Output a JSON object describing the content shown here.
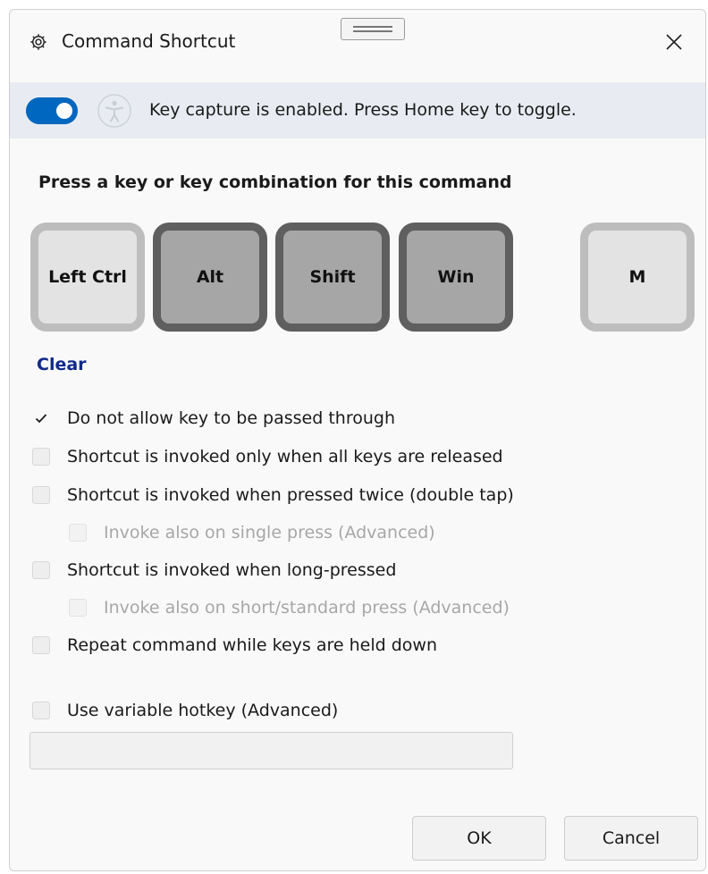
{
  "window": {
    "title": "Command Shortcut",
    "title_icon": "gear-icon",
    "close_icon": "close-icon"
  },
  "capture_bar": {
    "toggle_on": true,
    "message": "Key capture is enabled. Press Home key to toggle.",
    "accessibility_icon": "accessibility-icon"
  },
  "prompt": "Press a key or key combination for this command",
  "keys": [
    {
      "label": "Left Ctrl",
      "state": "inactive"
    },
    {
      "label": "Alt",
      "state": "active"
    },
    {
      "label": "Shift",
      "state": "active"
    },
    {
      "label": "Win",
      "state": "active"
    },
    {
      "label": "M",
      "state": "inactive"
    }
  ],
  "clear_label": "Clear",
  "options": [
    {
      "label": "Do not allow key to be passed through",
      "checked": true,
      "enabled": true
    },
    {
      "label": "Shortcut is invoked only when all keys are released",
      "checked": false,
      "enabled": true
    },
    {
      "label": "Shortcut is invoked when pressed twice (double tap)",
      "checked": false,
      "enabled": true
    },
    {
      "label": "Invoke also on single press (Advanced)",
      "checked": false,
      "enabled": false
    },
    {
      "label": "Shortcut is invoked when long-pressed",
      "checked": false,
      "enabled": true
    },
    {
      "label": "Invoke also on short/standard press (Advanced)",
      "checked": false,
      "enabled": false
    },
    {
      "label": "Repeat command while keys are held down",
      "checked": false,
      "enabled": true
    },
    {
      "label": "Use variable hotkey (Advanced)",
      "checked": false,
      "enabled": true
    }
  ],
  "variable_hotkey_value": "",
  "buttons": {
    "ok": "OK",
    "cancel": "Cancel"
  },
  "colors": {
    "accent": "#0067c0",
    "link": "#102a8a",
    "key_active": "#a6a6a6",
    "key_inactive": "#e3e3e3"
  }
}
